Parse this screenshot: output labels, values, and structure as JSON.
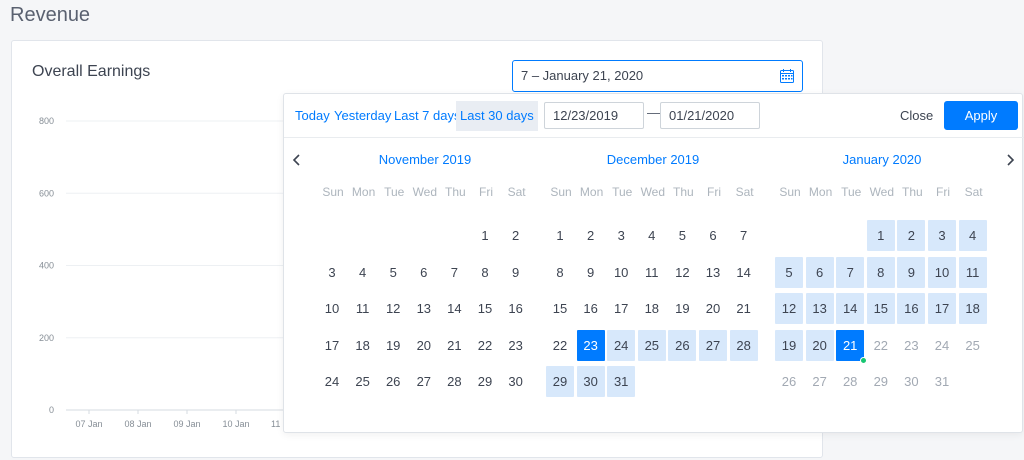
{
  "page": {
    "title": "Revenue"
  },
  "card": {
    "title": "Overall Earnings"
  },
  "date_input": {
    "value": "7 – January 21, 2020",
    "icon": "calendar-icon"
  },
  "chart_data": {
    "type": "line",
    "title": "",
    "xlabel": "",
    "ylabel": "",
    "y_ticks": [
      0,
      200,
      400,
      600,
      800
    ],
    "x_ticks": [
      "07 Jan",
      "08 Jan",
      "09 Jan",
      "10 Jan",
      "11"
    ],
    "ylim": [
      0,
      800
    ],
    "series": []
  },
  "picker": {
    "presets": [
      "Today",
      "Yesterday",
      "Last 7 days",
      "Last 30 days"
    ],
    "active_preset": "Last 30 days",
    "start": "12/23/2019",
    "separator": "—",
    "end": "01/21/2020",
    "close_label": "Close",
    "apply_label": "Apply",
    "prev_icon": "chevron-left-icon",
    "next_icon": "chevron-right-icon",
    "weekdays": [
      "Sun",
      "Mon",
      "Tue",
      "Wed",
      "Thu",
      "Fri",
      "Sat"
    ],
    "months": [
      {
        "title": "November 2019",
        "first_weekday": 5,
        "days_in_month": 30,
        "trailing_days": [],
        "range_start": null,
        "range_end": null,
        "selected": []
      },
      {
        "title": "December 2019",
        "first_weekday": 0,
        "days_in_month": 31,
        "trailing_days": [],
        "range_start": 23,
        "range_end": 31,
        "selected": [
          23
        ]
      },
      {
        "title": "January 2020",
        "first_weekday": 3,
        "days_in_month": 31,
        "trailing_days": [],
        "range_start": 1,
        "range_end": 21,
        "selected": [
          21
        ],
        "today": 21
      }
    ]
  }
}
